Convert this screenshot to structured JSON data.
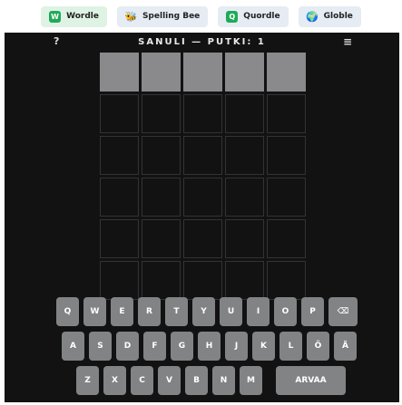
{
  "nav": {
    "items": [
      {
        "label": "Wordle",
        "icon": "wordle-icon",
        "glyph": "W",
        "variant": "wordle"
      },
      {
        "label": "Spelling Bee",
        "icon": "bee-icon",
        "glyph": "🐝",
        "variant": "spelling"
      },
      {
        "label": "Quordle",
        "icon": "quordle-icon",
        "glyph": "Q",
        "variant": "quordle"
      },
      {
        "label": "Globle",
        "icon": "globe-icon",
        "glyph": "🌍",
        "variant": "globle"
      }
    ]
  },
  "header": {
    "title": "SANULI — PUTKI: 1",
    "help_label": "?",
    "menu_label": "≡"
  },
  "board": {
    "rows": [
      [
        "",
        "",
        "",
        "",
        ""
      ],
      [
        "",
        "",
        "",
        "",
        ""
      ],
      [
        "",
        "",
        "",
        "",
        ""
      ],
      [
        "",
        "",
        "",
        "",
        ""
      ],
      [
        "",
        "",
        "",
        "",
        ""
      ],
      [
        "",
        "",
        "",
        "",
        ""
      ]
    ],
    "filled_rows": [
      0
    ]
  },
  "keyboard": {
    "rows": [
      [
        "Q",
        "W",
        "E",
        "R",
        "T",
        "Y",
        "U",
        "I",
        "O",
        "P",
        "⌫"
      ],
      [
        "A",
        "S",
        "D",
        "F",
        "G",
        "H",
        "J",
        "K",
        "L",
        "Ö",
        "Ä"
      ],
      [
        "Z",
        "X",
        "C",
        "V",
        "B",
        "N",
        "M",
        "ARVAA"
      ]
    ]
  },
  "colors": {
    "background": "#121213",
    "tile_border": "#333335",
    "tile_filled": "#8a8a8c",
    "key": "#818384",
    "text": "#ffffff"
  }
}
